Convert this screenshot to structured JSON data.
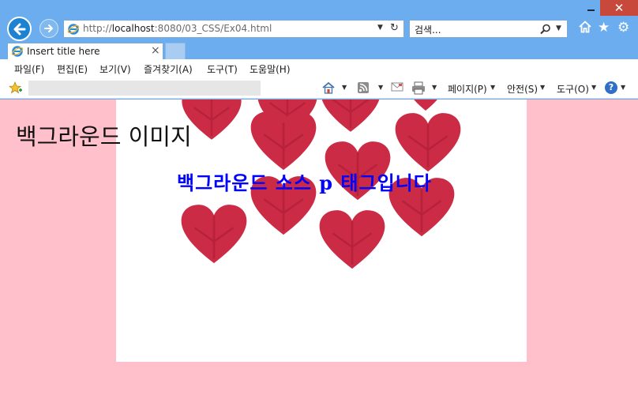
{
  "browser": {
    "close_glyph": "✕",
    "address": {
      "prefix": "http://",
      "host": "localhost",
      "path": ":8080/03_CSS/Ex04.html"
    },
    "search_placeholder": "검색...",
    "star_glyph": "★",
    "gear_glyph": "⚙",
    "tab_title": "Insert title here",
    "tab_close_glyph": "×",
    "menu": [
      "파일(F)",
      "편집(E)",
      "보기(V)",
      "즐겨찾기(A)",
      "도구(T)",
      "도움말(H)"
    ],
    "commands": {
      "page": "페이지(P)",
      "safety": "안전(S)",
      "tools": "도구(O)"
    },
    "help_glyph": "?"
  },
  "page": {
    "heading": "백그라운드 이미지",
    "paragraph": "백그라운드 소스 p 태그입니다",
    "background_color": "#ffc0cb",
    "panel_color": "#ffffff",
    "paragraph_color": "#0000ff",
    "heart_color": "#cc2b45"
  }
}
